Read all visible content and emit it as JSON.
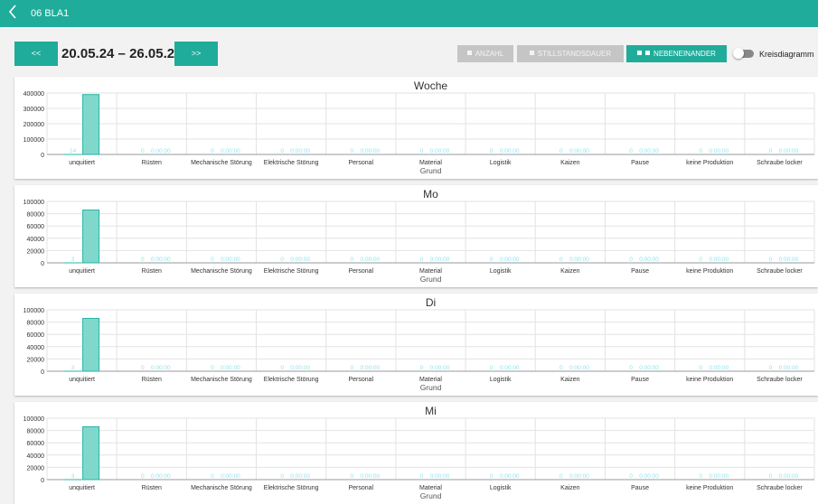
{
  "header": {
    "back_icon": "chevron-left-icon",
    "title": "06 BLA1"
  },
  "toolbar": {
    "prev_label": "<<",
    "next_label": ">>",
    "date_range": "20.05.24 – 26.05.24",
    "anzahl_label": "ANZAHL",
    "stillstandsdauer_label": "STILLSTANDSDAUER",
    "nebeneinander_label": "NEBENEINANDER",
    "kreisdiagramm_label": "Kreisdiagramm",
    "kreisdiagramm_on": false
  },
  "colors": {
    "accent": "#1fac9a",
    "bar_fill": "#80d8cd",
    "bar_stroke": "#26b5a3",
    "label_cyan": "#8fe6f0"
  },
  "chart_data": [
    {
      "type": "bar",
      "title": "Woche",
      "xlabel": "Grund",
      "ylabel": "",
      "categories": [
        "unquitiert",
        "Rüsten",
        "Mechanische Störung",
        "Elektrische Störung",
        "Personal",
        "Material",
        "Logistik",
        "Kaizen",
        "Pause",
        "keine Produktion",
        "Schraube locker"
      ],
      "series": [
        {
          "values": [
            14,
            0,
            0,
            0,
            0,
            0,
            0,
            0,
            0,
            0,
            0
          ]
        },
        {
          "values": [
            390000,
            0,
            0,
            0,
            0,
            0,
            0,
            0,
            0,
            0,
            0
          ]
        }
      ],
      "duration_labels": [
        "",
        "0:00:00",
        "0:00:00",
        "0:00:00",
        "0:00:00",
        "0:00:00",
        "0:00:00",
        "0:00:00",
        "0:00:00",
        "0:00:00",
        "0:00:00"
      ],
      "ylim": [
        0,
        400000
      ],
      "yticks": [
        0,
        100000,
        200000,
        300000,
        400000
      ]
    },
    {
      "type": "bar",
      "title": "Mo",
      "xlabel": "Grund",
      "ylabel": "",
      "categories": [
        "unquitiert",
        "Rüsten",
        "Mechanische Störung",
        "Elektrische Störung",
        "Personal",
        "Material",
        "Logistik",
        "Kaizen",
        "Pause",
        "keine Produktion",
        "Schraube locker"
      ],
      "series": [
        {
          "values": [
            3,
            0,
            0,
            0,
            0,
            0,
            0,
            0,
            0,
            0,
            0
          ]
        },
        {
          "values": [
            86000,
            0,
            0,
            0,
            0,
            0,
            0,
            0,
            0,
            0,
            0
          ]
        }
      ],
      "duration_labels": [
        "",
        "0:00:00",
        "0:00:00",
        "0:00:00",
        "0:00:00",
        "0:00:00",
        "0:00:00",
        "0:00:00",
        "0:00:00",
        "0:00:00",
        "0:00:00"
      ],
      "ylim": [
        0,
        100000
      ],
      "yticks": [
        0,
        20000,
        40000,
        60000,
        80000,
        100000
      ]
    },
    {
      "type": "bar",
      "title": "Di",
      "xlabel": "Grund",
      "ylabel": "",
      "categories": [
        "unquitiert",
        "Rüsten",
        "Mechanische Störung",
        "Elektrische Störung",
        "Personal",
        "Material",
        "Logistik",
        "Kaizen",
        "Pause",
        "keine Produktion",
        "Schraube locker"
      ],
      "series": [
        {
          "values": [
            3,
            0,
            0,
            0,
            0,
            0,
            0,
            0,
            0,
            0,
            0
          ]
        },
        {
          "values": [
            86000,
            0,
            0,
            0,
            0,
            0,
            0,
            0,
            0,
            0,
            0
          ]
        }
      ],
      "duration_labels": [
        "",
        "0:00:00",
        "0:00:00",
        "0:00:00",
        "0:00:00",
        "0:00:00",
        "0:00:00",
        "0:00:00",
        "0:00:00",
        "0:00:00",
        "0:00:00"
      ],
      "ylim": [
        0,
        100000
      ],
      "yticks": [
        0,
        20000,
        40000,
        60000,
        80000,
        100000
      ]
    },
    {
      "type": "bar",
      "title": "Mi",
      "xlabel": "Grund",
      "ylabel": "",
      "categories": [
        "unquitiert",
        "Rüsten",
        "Mechanische Störung",
        "Elektrische Störung",
        "Personal",
        "Material",
        "Logistik",
        "Kaizen",
        "Pause",
        "keine Produktion",
        "Schraube locker"
      ],
      "series": [
        {
          "values": [
            3,
            0,
            0,
            0,
            0,
            0,
            0,
            0,
            0,
            0,
            0
          ]
        },
        {
          "values": [
            86000,
            0,
            0,
            0,
            0,
            0,
            0,
            0,
            0,
            0,
            0
          ]
        }
      ],
      "duration_labels": [
        "",
        "0:00:00",
        "0:00:00",
        "0:00:00",
        "0:00:00",
        "0:00:00",
        "0:00:00",
        "0:00:00",
        "0:00:00",
        "0:00:00",
        "0:00:00"
      ],
      "ylim": [
        0,
        100000
      ],
      "yticks": [
        0,
        20000,
        40000,
        60000,
        80000,
        100000
      ]
    }
  ]
}
